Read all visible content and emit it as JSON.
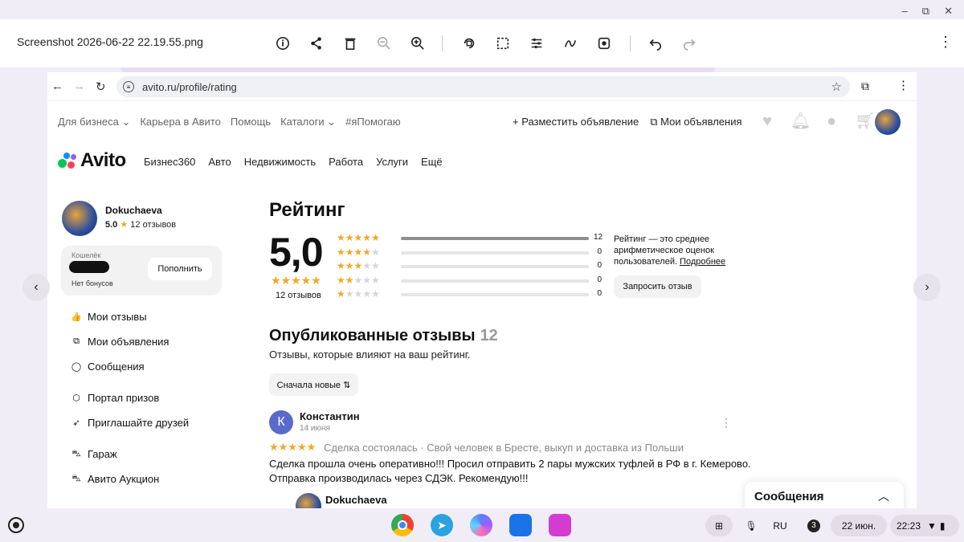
{
  "viewer": {
    "title": "Screenshot 2026-06-22 22.19.55.png"
  },
  "window_controls": [
    "–",
    "⧉",
    "✕"
  ],
  "browser": {
    "url": "avito.ru/profile/rating"
  },
  "avito_topnav": {
    "left": [
      "Для бизнеса ⌄",
      "Карьера в Авито",
      "Помощь",
      "Каталоги ⌄",
      "#яПомогаю"
    ],
    "post_ad": "+ Разместить объявление",
    "my_ads": "⧉ Мои объявления"
  },
  "logo": {
    "text": "Avito"
  },
  "main_nav": [
    "Бизнес360",
    "Авто",
    "Недвижимость",
    "Работа",
    "Услуги",
    "Ещё"
  ],
  "profile": {
    "name": "Dokuchaeva",
    "rating": "5.0",
    "star": "★",
    "reviews": "12 отзывов",
    "wallet_label": "Кошелёк",
    "bonus": "Нет бонусов",
    "topup": "Пополнить"
  },
  "sidebar_menu": [
    {
      "label": "Мои отзывы",
      "icon": "thumbs-up-icon",
      "glyph": "👍"
    },
    {
      "label": "Мои объявления",
      "icon": "copy-icon",
      "glyph": "⧉"
    },
    {
      "label": "Сообщения",
      "icon": "chat-icon",
      "glyph": "◯"
    },
    {
      "label": "Портал призов",
      "icon": "prize-icon",
      "glyph": "⬡"
    },
    {
      "label": "Приглашайте друзей",
      "icon": "rocket-icon",
      "glyph": "➶"
    },
    {
      "label": "Гараж",
      "icon": "car-icon",
      "glyph": "⛍"
    },
    {
      "label": "Авито Аукцион",
      "icon": "auction-car-icon",
      "glyph": "⛍"
    }
  ],
  "rating": {
    "heading": "Рейтинг",
    "score": "5,0",
    "stars": "★★★★★",
    "count": "12 отзывов",
    "distribution": [
      {
        "stars": 5,
        "count": 12,
        "share": 1.0
      },
      {
        "stars": 4,
        "count": 0,
        "share": 0
      },
      {
        "stars": 3,
        "count": 0,
        "share": 0
      },
      {
        "stars": 2,
        "count": 0,
        "share": 0
      },
      {
        "stars": 1,
        "count": 0,
        "share": 0
      }
    ],
    "info": "Рейтинг — это среднее арифметическое оценок пользователей.",
    "info_link": "Подробнее",
    "request_button": "Запросить отзыв"
  },
  "published": {
    "heading": "Опубликованные отзывы",
    "count": "12",
    "subtitle": "Отзывы, которые влияют на ваш рейтинг.",
    "sort_button": "Сначала новые ⇅"
  },
  "review": {
    "avatar_letter": "К",
    "author": "Константин",
    "date": "14 июня",
    "stars": "★★★★★",
    "deal": "Сделка состоялась · Свой человек в Бресте, выкуп и доставка из Польши",
    "text": "Сделка прошла очень оперативно!!! Просил отправить 2 пары мужских туфлей в РФ в г. Кемерово. Отправка производилась через СДЭК. Рекомендую!!!",
    "reply_author": "Dokuchaeva",
    "more": "⋮"
  },
  "messages_panel": {
    "title": "Сообщения",
    "chevron": "︿"
  },
  "taskbar": {
    "lang": "RU",
    "badge": "3",
    "date": "22 июн.",
    "time": "22:23"
  },
  "colors": {
    "star": "#f5a623",
    "avatar_k": "#5a6ac9",
    "panel_bg": "#f2f2f2"
  }
}
